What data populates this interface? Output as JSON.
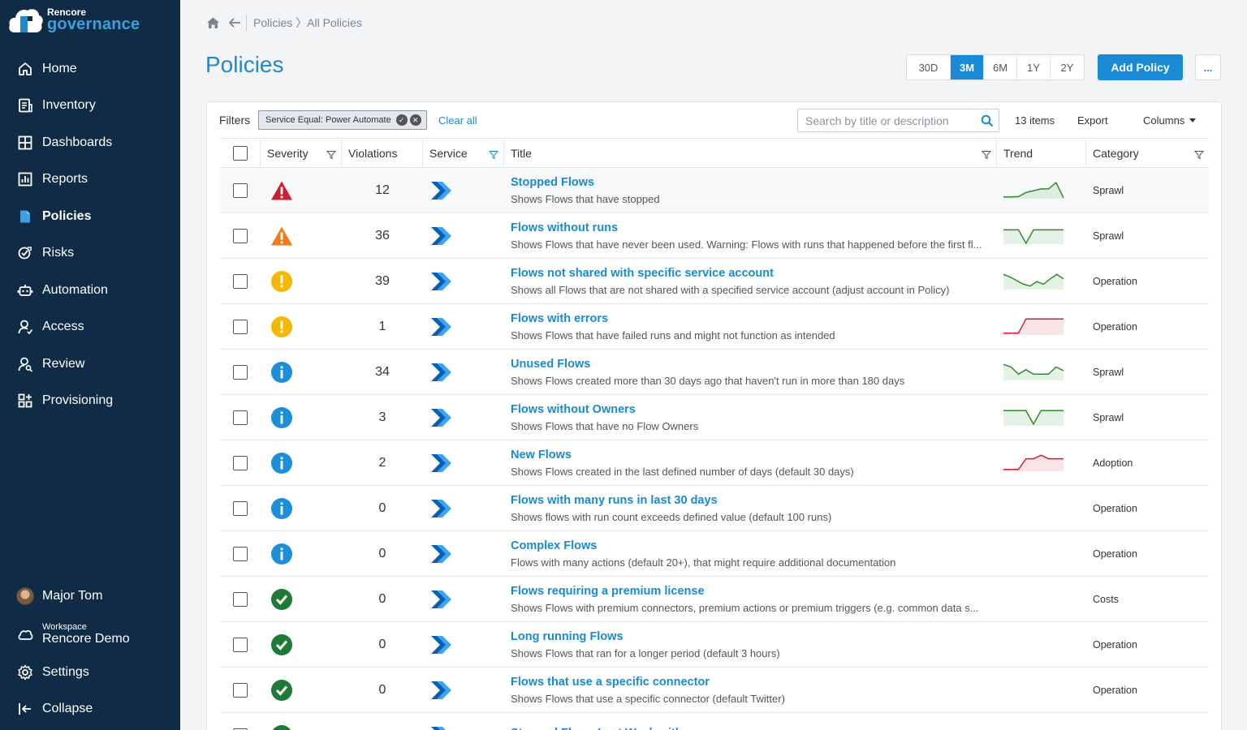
{
  "app": {
    "logo_small": "Rencore",
    "logo_big": "governance"
  },
  "sidebar": {
    "items": [
      {
        "label": "Home",
        "icon": "home-icon"
      },
      {
        "label": "Inventory",
        "icon": "inventory-icon"
      },
      {
        "label": "Dashboards",
        "icon": "dashboards-icon"
      },
      {
        "label": "Reports",
        "icon": "reports-icon"
      },
      {
        "label": "Policies",
        "icon": "policies-icon",
        "active": true
      },
      {
        "label": "Risks",
        "icon": "risks-icon"
      },
      {
        "label": "Automation",
        "icon": "automation-icon"
      },
      {
        "label": "Access",
        "icon": "access-icon"
      },
      {
        "label": "Review",
        "icon": "review-icon"
      },
      {
        "label": "Provisioning",
        "icon": "provisioning-icon"
      }
    ],
    "user_name": "Major Tom",
    "workspace_label": "Workspace",
    "workspace_name": "Rencore Demo",
    "settings_label": "Settings",
    "collapse_label": "Collapse"
  },
  "breadcrumb": {
    "path": "Policies 〉All Policies"
  },
  "page_title": "Policies",
  "ranges": [
    "30D",
    "3M",
    "6M",
    "1Y",
    "2Y"
  ],
  "active_range": "3M",
  "add_policy_label": "Add Policy",
  "more_label": "...",
  "filters": {
    "label": "Filters",
    "chip_text": "Service Equal: Power Automate",
    "clear_all": "Clear all"
  },
  "search": {
    "placeholder": "Search by title or description",
    "value": ""
  },
  "items_count": "13 items",
  "export_label": "Export",
  "columns_label": "Columns",
  "table": {
    "headers": {
      "severity": "Severity",
      "violations": "Violations",
      "service": "Service",
      "title": "Title",
      "trend": "Trend",
      "category": "Category"
    },
    "rows": [
      {
        "severity": "critical",
        "violations": "12",
        "title": "Stopped Flows",
        "description": "Shows Flows that have stopped",
        "category": "Sprawl",
        "trend_color": "#2e8b2e",
        "trend": [
          0.1,
          0.1,
          0.12,
          0.35,
          0.45,
          0.55,
          0.55,
          0.9,
          0.05
        ]
      },
      {
        "severity": "high",
        "violations": "36",
        "title": "Flows without runs",
        "description": "Shows Flows that have never been used. Warning: Flows with runs that happened before the first fl...",
        "category": "Sprawl",
        "trend_color": "#2e8b2e",
        "trend": [
          0.8,
          0.8,
          0.8,
          0.05,
          0.8,
          0.8,
          0.8,
          0.8,
          0.8
        ]
      },
      {
        "severity": "medium",
        "violations": "39",
        "title": "Flows not shared with specific service account",
        "description": "Shows all Flows that are not shared with a specified service account (adjust account in Policy)",
        "category": "Operation",
        "trend_color": "#2e8b2e",
        "trend": [
          0.85,
          0.7,
          0.5,
          0.3,
          0.2,
          0.45,
          0.3,
          0.6,
          0.85,
          0.6
        ]
      },
      {
        "severity": "medium",
        "violations": "1",
        "title": "Flows with errors",
        "description": "Shows Flows that have failed runs and might not function as intended",
        "category": "Operation",
        "trend_color": "#cc1f33",
        "trend": [
          0.1,
          0.1,
          0.1,
          0.9,
          0.9,
          0.9,
          0.9,
          0.9,
          0.9
        ]
      },
      {
        "severity": "info",
        "violations": "34",
        "title": "Unused Flows",
        "description": "Shows Flows created more than 30 days ago that haven't run in more than 180 days",
        "category": "Sprawl",
        "trend_color": "#2e8b2e",
        "trend": [
          0.9,
          0.75,
          0.35,
          0.6,
          0.35,
          0.35,
          0.35,
          0.75,
          0.55
        ]
      },
      {
        "severity": "info",
        "violations": "3",
        "title": "Flows without Owners",
        "description": "Shows Flows that have no Flow Owners",
        "category": "Sprawl",
        "trend_color": "#2e8b2e",
        "trend": [
          0.85,
          0.85,
          0.85,
          0.85,
          0.1,
          0.85,
          0.85,
          0.85,
          0.85
        ]
      },
      {
        "severity": "info",
        "violations": "2",
        "title": "New Flows",
        "description": "Shows Flows created in the last defined number of days (default 30 days)",
        "category": "Adoption",
        "trend_color": "#cc1f33",
        "trend": [
          0.1,
          0.1,
          0.1,
          0.7,
          0.7,
          0.9,
          0.7,
          0.7,
          0.7
        ]
      },
      {
        "severity": "info",
        "violations": "0",
        "title": "Flows with many runs in last 30 days",
        "description": "Shows flows with run count exceeds defined value (default 100 runs)",
        "category": "Operation",
        "trend_color": "",
        "trend": []
      },
      {
        "severity": "info",
        "violations": "0",
        "title": "Complex Flows",
        "description": "Flows with many actions (default 20+), that might require additional documentation",
        "category": "Operation",
        "trend_color": "",
        "trend": []
      },
      {
        "severity": "ok",
        "violations": "0",
        "title": "Flows requiring a premium license",
        "description": "Shows Flows with premium connectors, premium actions or premium triggers (e.g. common data s...",
        "category": "Costs",
        "trend_color": "",
        "trend": []
      },
      {
        "severity": "ok",
        "violations": "0",
        "title": "Long running Flows",
        "description": "Shows Flows that ran for a longer period (default 3 hours)",
        "category": "Operation",
        "trend_color": "",
        "trend": []
      },
      {
        "severity": "ok",
        "violations": "0",
        "title": "Flows that use a specific connector",
        "description": "Shows Flows that use a specific connector (default Twitter)",
        "category": "Operation",
        "trend_color": "",
        "trend": []
      },
      {
        "severity": "ok",
        "violations": "0",
        "title": "Stopped Flows Last Week with errors",
        "description": "",
        "category": "",
        "trend_color": "",
        "trend": []
      }
    ]
  },
  "colors": {
    "sidebar_bg": "#0f2b45",
    "accent": "#1a8ad4",
    "critical": "#cc1f33",
    "high": "#f07d1a",
    "medium": "#f5b800",
    "info": "#1b8fd9",
    "ok": "#1e7a36"
  }
}
